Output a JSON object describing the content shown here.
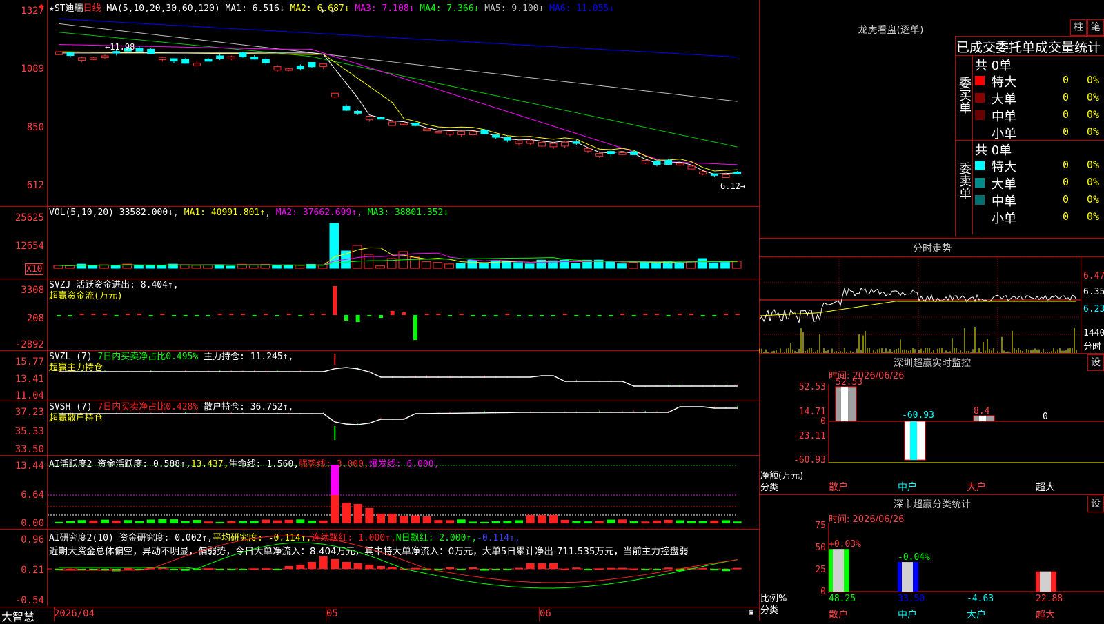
{
  "header": {
    "star": "★",
    "stock": "ST迪瑞",
    "period": "日线",
    "ma_params": "MA(5,10,20,30,60,120)",
    "ma": [
      {
        "label": "MA1:",
        "value": "6.516↓",
        "color": "#ffffff"
      },
      {
        "label": "MA2:",
        "value": "6.687↓",
        "color": "#ffff00"
      },
      {
        "label": "MA3:",
        "value": "7.108↓",
        "color": "#ff00ff"
      },
      {
        "label": "MA4:",
        "value": "7.366↓",
        "color": "#00ff00"
      },
      {
        "label": "MA5:",
        "value": "9.100↓",
        "color": "#c0c0c0"
      },
      {
        "label": "MA6:",
        "value": "11.055↓",
        "color": "#0000ff"
      }
    ]
  },
  "price_panel": {
    "yticks": [
      "1327",
      "1089",
      "850",
      "612"
    ],
    "high_label": "11.98",
    "low_label": "6.12→",
    "icon": "alert-icon"
  },
  "vol_panel": {
    "legend": "VOL(5,10,20)",
    "vol": "33582.000↓",
    "ma1": "MA1: 40991.801↑",
    "ma2": "MA2: 37662.699↑",
    "ma3": "MA3: 38801.352↓",
    "yticks": [
      "25625",
      "12654"
    ],
    "unit": "X10"
  },
  "svzj": {
    "legend1": "SVZJ  活跃资金进出: 8.404↑,",
    "legend2": "超赢资金流(万元)",
    "yticks": [
      "3308",
      "208",
      "-2892"
    ]
  },
  "svzl": {
    "legend_name": "SVZL (7)",
    "legend_a": "7日内买卖净占比0.495%",
    "legend_b": "主力持仓: 11.245↑,",
    "legend2": "超赢主力持仓",
    "yticks": [
      "15.77",
      "13.41",
      "11.04"
    ]
  },
  "svsh": {
    "legend_name": "SVSH (7)",
    "legend_a": "7日内买卖净占比0.428%",
    "legend_b": "散户持仓: 36.752↑,",
    "legend2": "超赢散户持仓",
    "yticks": [
      "37.23",
      "35.33",
      "33.50"
    ]
  },
  "ai_active": {
    "legend_a": "AI活跃度2 资金活跃度: 0.588↑,",
    "legend_b": "13.437,",
    "legend_c": "生命线: 1.560,",
    "legend_d": "强势线: 3.000,",
    "legend_e": "爆发线: 6.000,",
    "yticks": [
      "13.44",
      "6.64",
      "0.00"
    ]
  },
  "ai_research": {
    "legend_a": "AI研究度2(10) 资金研究度: 0.002↑,",
    "legend_b": "平均研究度: -0.114↑,",
    "legend_c": "连续飘红: 1.000↑,",
    "legend_d": "N日飘红: 2.000↑,",
    "legend_e": "-0.114↑,",
    "comment": "近期大资金总体偏空，异动不明显，偏弱势，今日大单净流入：8.404万元，其中特大单净流入：0万元，大单5日累计净出-711.535万元，当前主力控盘弱",
    "yticks": [
      "0.96",
      "0.21",
      "-0.54"
    ]
  },
  "footer": {
    "brand": "大智慧",
    "dates": [
      "2026/04",
      "05",
      "06"
    ]
  },
  "lhb": {
    "title": "龙虎看盘(逐单)",
    "btn1": "柱",
    "btn2": "笔",
    "tabs": "已成交委托单成交量统计",
    "buy": {
      "side": "委买单",
      "total": "共 0单",
      "rows": [
        {
          "label": "特大",
          "v": "0",
          "p": "0%",
          "color": "#ff0000"
        },
        {
          "label": "大单",
          "v": "0",
          "p": "0%",
          "color": "#8b0000"
        },
        {
          "label": "中单",
          "v": "0",
          "p": "0%",
          "color": "#6a0000"
        },
        {
          "label": "小单",
          "v": "0",
          "p": "0%",
          "color": ""
        }
      ]
    },
    "sell": {
      "side": "委卖单",
      "total": "共 0单",
      "rows": [
        {
          "label": "特大",
          "v": "0",
          "p": "0%",
          "color": "#00ffff"
        },
        {
          "label": "大单",
          "v": "0",
          "p": "0%",
          "color": "#008b8b"
        },
        {
          "label": "中单",
          "v": "0",
          "p": "0%",
          "color": "#007070"
        },
        {
          "label": "小单",
          "v": "0",
          "p": "0%",
          "color": ""
        }
      ]
    }
  },
  "intraday": {
    "title": "分时走势",
    "yticks": [
      "6.47",
      "6.35",
      "6.23"
    ],
    "vol_tick": "1440",
    "vol_unit": "分时"
  },
  "sz_monitor": {
    "title": "深圳超赢实时监控",
    "btn": "设",
    "time": "时间: 2026/06/26",
    "ylab": "净额(万元)",
    "xlab": "分类",
    "yticks": [
      "52.53",
      "14.71",
      "0",
      "-23.11",
      "-60.93"
    ],
    "chart_data": {
      "type": "bar",
      "categories": [
        "散户",
        "中户",
        "大户",
        "超大"
      ],
      "values": [
        52.53,
        -60.93,
        8.4,
        0
      ],
      "labels": [
        "52.53",
        "-60.93",
        "8.4",
        "0"
      ]
    }
  },
  "sz_class": {
    "title": "深市超赢分类统计",
    "btn": "设",
    "time": "时间: 2026/06/26",
    "ylab": "比例%",
    "xlab": "分类",
    "yticks": [
      "75",
      "50",
      "25",
      "0"
    ],
    "chart_data": {
      "type": "bar",
      "categories": [
        "散户",
        "中户",
        "大户",
        "超大"
      ],
      "values": [
        48.25,
        33.5,
        -4.63,
        22.88
      ],
      "top_labels": [
        "+0.03%",
        "-0.04%",
        "",
        ""
      ],
      "bottom_labels": [
        "48.25",
        "33.50",
        "-4.63",
        "22.88"
      ]
    }
  },
  "chart_data": {
    "type": "candlestick",
    "title": "ST迪瑞 日线",
    "ylim": [
      6.12,
      13.27
    ],
    "note": "daily candles with 6 moving averages"
  }
}
